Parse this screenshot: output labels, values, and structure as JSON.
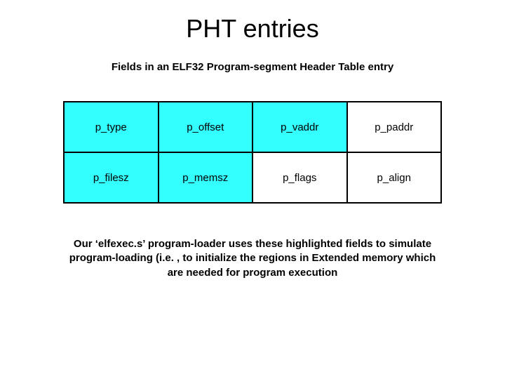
{
  "title": "PHT entries",
  "subtitle": "Fields in an ELF32 Program-segment Header Table entry",
  "table": {
    "rows": [
      [
        {
          "label": "p_type",
          "highlighted": true
        },
        {
          "label": "p_offset",
          "highlighted": true
        },
        {
          "label": "p_vaddr",
          "highlighted": true
        },
        {
          "label": "p_paddr",
          "highlighted": false
        }
      ],
      [
        {
          "label": "p_filesz",
          "highlighted": true
        },
        {
          "label": "p_memsz",
          "highlighted": true
        },
        {
          "label": "p_flags",
          "highlighted": false
        },
        {
          "label": "p_align",
          "highlighted": false
        }
      ]
    ]
  },
  "footer": "Our ‘elfexec.s’ program-loader uses these highlighted fields to simulate program-loading (i.e. , to initialize the regions in Extended memory which are needed for program execution",
  "colors": {
    "highlight": "#33ffff",
    "plain": "#ffffff",
    "border": "#000000"
  }
}
